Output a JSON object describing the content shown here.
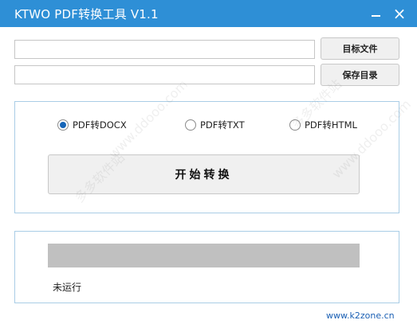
{
  "window": {
    "title": "KTWO PDF转换工具 V1.1",
    "minimize_glyph": "",
    "close_glyph": "×"
  },
  "files": {
    "target_file_value": "",
    "save_dir_value": "",
    "target_file_button": "目标文件",
    "save_dir_button": "保存目录"
  },
  "modes": {
    "options": [
      "PDF转DOCX",
      "PDF转TXT",
      "PDF转HTML"
    ],
    "selected": "PDF转DOCX"
  },
  "actions": {
    "start_button": "开始转换"
  },
  "progress": {
    "value": 0,
    "status": "未运行"
  },
  "footer": {
    "site": "www.k2zone.cn"
  },
  "watermark": {
    "text1": "多多软件站",
    "text2": "www.ddooo.com"
  },
  "colors": {
    "titlebar": "#2e8fd6",
    "group_border": "#a9cde6",
    "progress_track": "#c0c0c0",
    "radio_selected": "#1565b8",
    "link": "#1a5fb4"
  }
}
